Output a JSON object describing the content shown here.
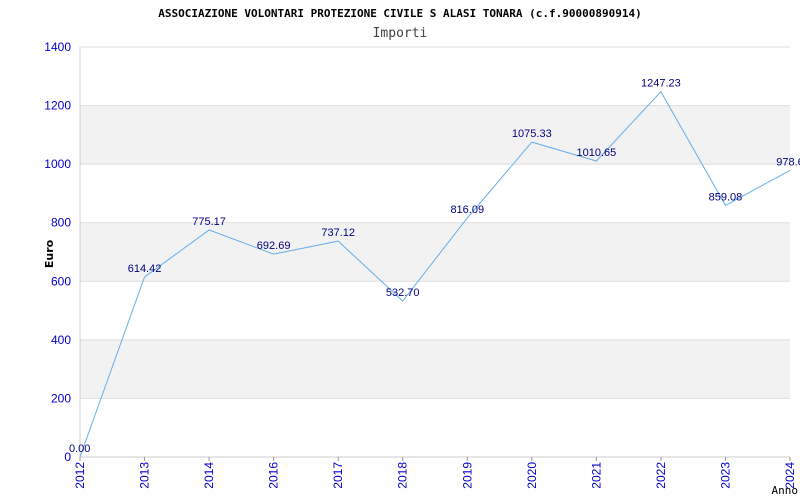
{
  "chart_data": {
    "type": "line",
    "title": "ASSOCIAZIONE VOLONTARI PROTEZIONE CIVILE S ALASI TONARA (c.f.90000890914)",
    "subtitle": "Importi",
    "xlabel": "Anno",
    "ylabel": "Euro",
    "ylim": [
      0,
      1400
    ],
    "yticks": [
      "0",
      "200",
      "400",
      "600",
      "800",
      "1000",
      "1200",
      "1400"
    ],
    "grid": true,
    "categories": [
      "2012",
      "2013",
      "2014",
      "2016",
      "2017",
      "2018",
      "2019",
      "2020",
      "2021",
      "2022",
      "2023",
      "2024"
    ],
    "values": [
      0.0,
      614.42,
      775.17,
      692.69,
      737.12,
      532.7,
      816.09,
      1075.33,
      1010.65,
      1247.23,
      859.08,
      978.6
    ],
    "labels": [
      "0.00",
      "614.42",
      "775.17",
      "692.69",
      "737.12",
      "532.70",
      "816.09",
      "1075.33",
      "1010.65",
      "1247.23",
      "859.08",
      "978.6"
    ],
    "colors": {
      "line": "#6aaee8",
      "band": "#f2f2f2",
      "grid": "#dddddd",
      "tick": "#0000cc",
      "label": "#000080"
    }
  }
}
